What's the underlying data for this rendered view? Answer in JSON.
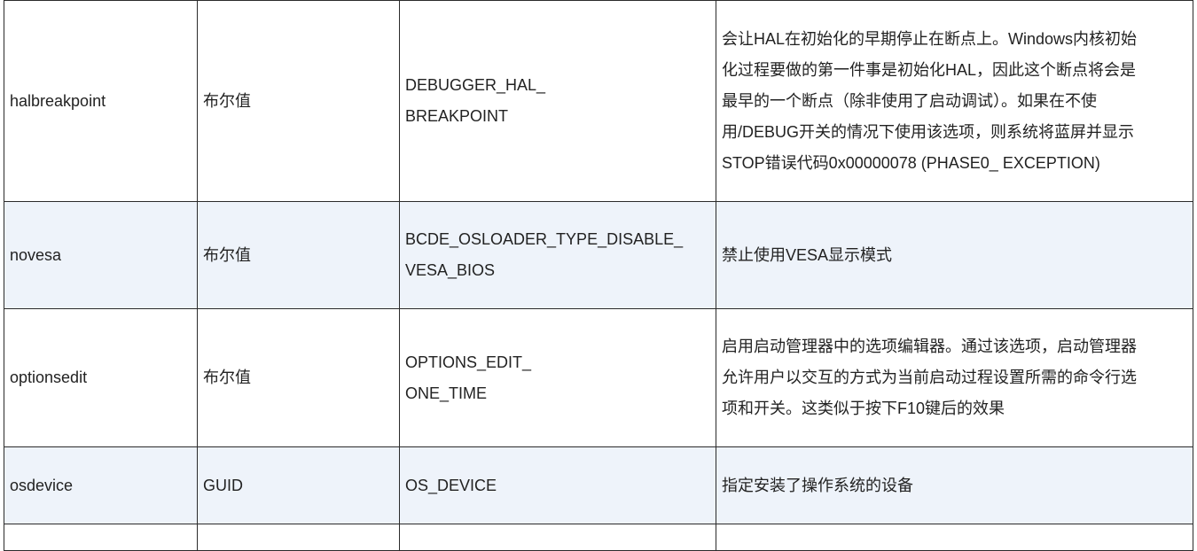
{
  "rows": [
    {
      "name": "halbreakpoint",
      "type": "布尔值",
      "const": [
        "DEBUGGER_HAL_",
        "BREAKPOINT"
      ],
      "desc": [
        "会让HAL在初始化的早期停止在断点上。Windows内核初始",
        "化过程要做的第一件事是初始化HAL，因此这个断点将会是",
        "最早的一个断点（除非使用了启动调试）。如果在不使",
        "用/DEBUG开关的情况下使用该选项，则系统将蓝屏并显示",
        "STOP错误代码0x00000078 (PHASE0_ EXCEPTION)"
      ]
    },
    {
      "name": "novesa",
      "type": "布尔值",
      "const": [
        "BCDE_OSLOADER_TYPE_DISABLE_",
        "VESA_BIOS"
      ],
      "desc": [
        "禁止使用VESA显示模式"
      ]
    },
    {
      "name": "optionsedit",
      "type": "布尔值",
      "const": [
        "OPTIONS_EDIT_",
        "ONE_TIME"
      ],
      "desc": [
        "启用启动管理器中的选项编辑器。通过该选项，启动管理器",
        "允许用户以交互的方式为当前启动过程设置所需的命令行选",
        "项和开关。这类似于按下F10键后的效果"
      ]
    },
    {
      "name": "osdevice",
      "type": "GUID",
      "const": [
        "OS_DEVICE"
      ],
      "desc": [
        "指定安装了操作系统的设备"
      ]
    }
  ]
}
